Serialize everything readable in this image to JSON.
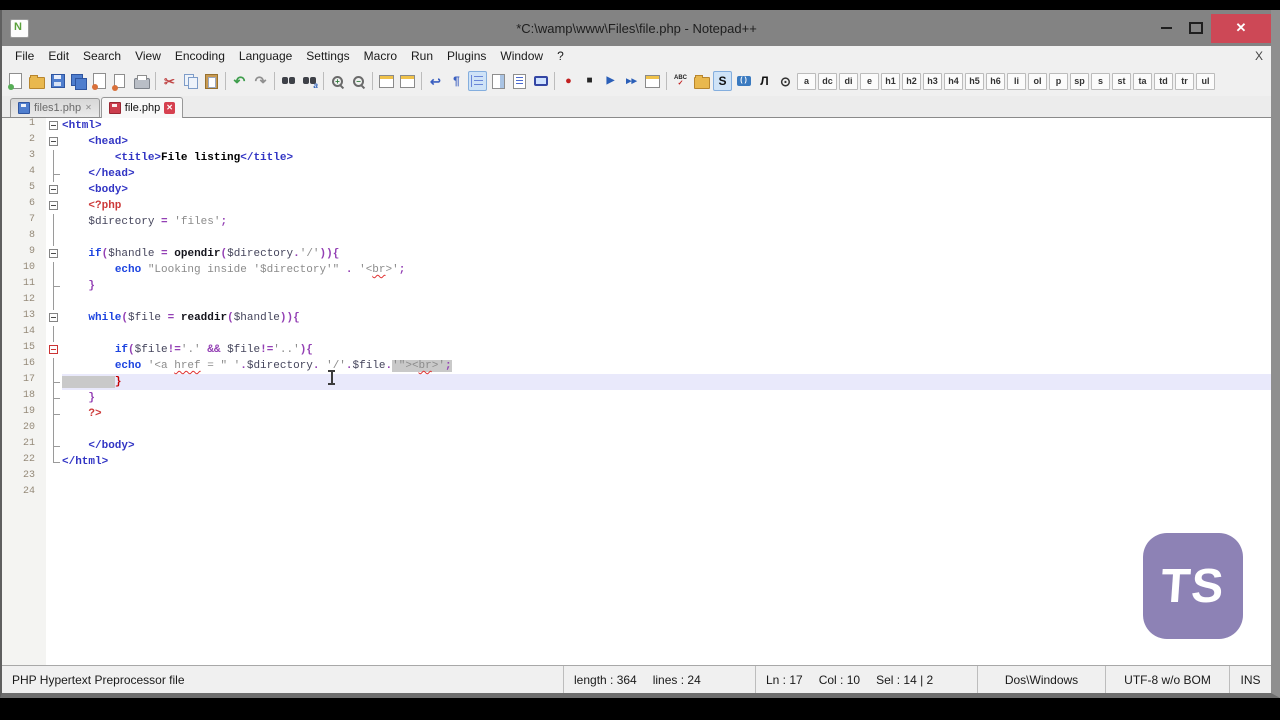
{
  "window": {
    "title": "*C:\\wamp\\www\\Files\\file.php - Notepad++"
  },
  "menu": {
    "items": [
      "File",
      "Edit",
      "Search",
      "View",
      "Encoding",
      "Language",
      "Settings",
      "Macro",
      "Run",
      "Plugins",
      "Window",
      "?"
    ],
    "close_label": "X"
  },
  "toolbar": {
    "items": [
      {
        "n": "new-file-icon",
        "k": "page",
        "c": "#57ae57"
      },
      {
        "n": "open-file-icon",
        "k": "folder"
      },
      {
        "n": "save-icon",
        "k": "floppy"
      },
      {
        "n": "save-all-icon",
        "k": "floppy2"
      },
      {
        "n": "close-file-icon",
        "k": "page",
        "c": "#d9703a"
      },
      {
        "n": "close-all-icon",
        "k": "page2"
      },
      {
        "n": "print-icon",
        "k": "printer"
      },
      {
        "k": "sep"
      },
      {
        "n": "cut-icon",
        "k": "g",
        "g": "✂",
        "c": "#c04545",
        "fs": 13
      },
      {
        "n": "copy-icon",
        "k": "copy"
      },
      {
        "n": "paste-icon",
        "k": "paste"
      },
      {
        "k": "sep"
      },
      {
        "n": "undo-icon",
        "k": "g",
        "g": "↶",
        "c": "#3f9e4d",
        "fs": 14
      },
      {
        "n": "redo-icon",
        "k": "g",
        "g": "↷",
        "c": "#909090",
        "fs": 14
      },
      {
        "k": "sep"
      },
      {
        "n": "find-icon",
        "k": "binoc"
      },
      {
        "n": "replace-icon",
        "k": "binoc2"
      },
      {
        "k": "sep"
      },
      {
        "n": "zoom-in-icon",
        "k": "zoom",
        "g": "+"
      },
      {
        "n": "zoom-out-icon",
        "k": "zoom",
        "g": "−"
      },
      {
        "k": "sep"
      },
      {
        "n": "sync-vertical-icon",
        "k": "docwin"
      },
      {
        "n": "sync-horizontal-icon",
        "k": "docwin"
      },
      {
        "k": "sep"
      },
      {
        "n": "word-wrap-icon",
        "k": "g",
        "g": "↩",
        "c": "#3a5fc0",
        "fs": 13
      },
      {
        "n": "show-all-chars-icon",
        "k": "g",
        "g": "¶",
        "c": "#3a5fc0",
        "fs": 12
      },
      {
        "n": "indent-guide-icon",
        "k": "guide",
        "act": true
      },
      {
        "n": "doc-map-icon",
        "k": "docmap"
      },
      {
        "n": "function-list-icon",
        "k": "flist"
      },
      {
        "n": "monitoring-icon",
        "k": "monitor"
      },
      {
        "k": "sep"
      },
      {
        "n": "macro-record-icon",
        "k": "g",
        "g": "●",
        "c": "#c22020",
        "fs": 11
      },
      {
        "n": "macro-stop-icon",
        "k": "g",
        "g": "■",
        "c": "#262626",
        "fs": 10
      },
      {
        "n": "macro-play-icon",
        "k": "g",
        "g": "▶",
        "c": "#2b5fb8",
        "fs": 10
      },
      {
        "n": "macro-run-multi-icon",
        "k": "g",
        "g": "▶▶",
        "c": "#2b5fb8",
        "fs": 7
      },
      {
        "n": "macro-save-icon",
        "k": "docwin"
      },
      {
        "k": "sep"
      },
      {
        "n": "spell-check-icon",
        "k": "abc"
      },
      {
        "n": "plugin-folder-icon",
        "k": "folder"
      },
      {
        "n": "style-token-icon",
        "k": "g",
        "g": "S",
        "c": "#111111",
        "fs": 12,
        "act": true
      },
      {
        "n": "preview-monitor-icon",
        "k": "mon2"
      },
      {
        "n": "textfx-icon",
        "k": "g",
        "g": "Л",
        "c": "#111111",
        "fs": 12
      },
      {
        "n": "clock-icon",
        "k": "g",
        "g": "⊙",
        "c": "#333333",
        "fs": 13
      }
    ],
    "tag_buttons": [
      "a",
      "dc",
      "di",
      "e",
      "h1",
      "h2",
      "h3",
      "h4",
      "h5",
      "h6",
      "li",
      "ol",
      "p",
      "sp",
      "s",
      "st",
      "ta",
      "td",
      "tr",
      "ul"
    ]
  },
  "tabs": [
    {
      "label": "files1.php",
      "modified": false,
      "active": false,
      "close_glyph": "✕"
    },
    {
      "label": "file.php",
      "modified": true,
      "active": true,
      "close_glyph": "✕"
    }
  ],
  "editor": {
    "current_line": 17,
    "lines": [
      {
        "n": 1,
        "f": "minus",
        "s": [
          [
            "tag",
            "<html>"
          ]
        ]
      },
      {
        "n": 2,
        "f": "minus",
        "s": [
          [
            "pl",
            "    "
          ],
          [
            "tag",
            "<head>"
          ]
        ]
      },
      {
        "n": 3,
        "f": "line",
        "s": [
          [
            "pl",
            "        "
          ],
          [
            "tag",
            "<title>"
          ],
          [
            "txt",
            "File listing"
          ],
          [
            "tag",
            "</title>"
          ]
        ]
      },
      {
        "n": 4,
        "f": "tick",
        "s": [
          [
            "pl",
            "    "
          ],
          [
            "tag",
            "</head>"
          ]
        ]
      },
      {
        "n": 5,
        "f": "minus",
        "s": [
          [
            "pl",
            "    "
          ],
          [
            "tag",
            "<body>"
          ]
        ]
      },
      {
        "n": 6,
        "f": "minus",
        "s": [
          [
            "pl",
            "    "
          ],
          [
            "php",
            "<?php"
          ]
        ]
      },
      {
        "n": 7,
        "f": "line",
        "s": [
          [
            "pl",
            "    "
          ],
          [
            "var",
            "$directory"
          ],
          [
            "pl",
            " "
          ],
          [
            "op",
            "="
          ],
          [
            "pl",
            " "
          ],
          [
            "str",
            "'files'"
          ],
          [
            "op",
            ";"
          ]
        ]
      },
      {
        "n": 8,
        "f": "line",
        "s": []
      },
      {
        "n": 9,
        "f": "minus",
        "s": [
          [
            "pl",
            "    "
          ],
          [
            "kw",
            "if"
          ],
          [
            "op",
            "("
          ],
          [
            "var",
            "$handle"
          ],
          [
            "pl",
            " "
          ],
          [
            "op",
            "="
          ],
          [
            "pl",
            " "
          ],
          [
            "fn",
            "opendir"
          ],
          [
            "op",
            "("
          ],
          [
            "var",
            "$directory"
          ],
          [
            "op",
            "."
          ],
          [
            "str",
            "'/'"
          ],
          [
            "op",
            ")){"
          ]
        ]
      },
      {
        "n": 10,
        "f": "line",
        "s": [
          [
            "pl",
            "        "
          ],
          [
            "kw",
            "echo"
          ],
          [
            "pl",
            " "
          ],
          [
            "str",
            "\"Looking inside '$directory'\""
          ],
          [
            "pl",
            " "
          ],
          [
            "op",
            "."
          ],
          [
            "pl",
            " "
          ],
          [
            "str",
            "'<"
          ],
          [
            "strq",
            "br"
          ],
          [
            "str",
            ">'"
          ],
          [
            "op",
            ";"
          ]
        ]
      },
      {
        "n": 11,
        "f": "tick",
        "s": [
          [
            "pl",
            "    "
          ],
          [
            "op",
            "}"
          ]
        ]
      },
      {
        "n": 12,
        "f": "line",
        "s": []
      },
      {
        "n": 13,
        "f": "minus",
        "s": [
          [
            "pl",
            "    "
          ],
          [
            "kw",
            "while"
          ],
          [
            "op",
            "("
          ],
          [
            "var",
            "$file"
          ],
          [
            "pl",
            " "
          ],
          [
            "op",
            "="
          ],
          [
            "pl",
            " "
          ],
          [
            "fn",
            "readdir"
          ],
          [
            "op",
            "("
          ],
          [
            "var",
            "$handle"
          ],
          [
            "op",
            ")){"
          ]
        ]
      },
      {
        "n": 14,
        "f": "line",
        "s": []
      },
      {
        "n": 15,
        "f": "minusred",
        "s": [
          [
            "pl",
            "        "
          ],
          [
            "kw",
            "if"
          ],
          [
            "op",
            "("
          ],
          [
            "var",
            "$file"
          ],
          [
            "op",
            "!="
          ],
          [
            "str",
            "'.'"
          ],
          [
            "pl",
            " "
          ],
          [
            "op",
            "&&"
          ],
          [
            "pl",
            " "
          ],
          [
            "var",
            "$file"
          ],
          [
            "op",
            "!="
          ],
          [
            "str",
            "'..'"
          ],
          [
            "op",
            "){"
          ]
        ]
      },
      {
        "n": 16,
        "f": "line",
        "s": [
          [
            "pl",
            "        "
          ],
          [
            "kw",
            "echo"
          ],
          [
            "pl",
            " "
          ],
          [
            "str",
            "'<a "
          ],
          [
            "strq",
            "href"
          ],
          [
            "str",
            " = \" '"
          ],
          [
            "op",
            "."
          ],
          [
            "var",
            "$directory"
          ],
          [
            "op",
            "."
          ],
          [
            "pl",
            " "
          ],
          [
            "str",
            "'/'"
          ],
          [
            "op",
            "."
          ],
          [
            "var",
            "$file"
          ],
          [
            "op",
            "."
          ],
          [
            "str sel",
            "'\"><"
          ],
          [
            "strq sel",
            "br"
          ],
          [
            "str sel",
            ">'"
          ],
          [
            "op sel",
            ";"
          ]
        ]
      },
      {
        "n": 17,
        "f": "tick",
        "s": [
          [
            "pl sel",
            "        "
          ],
          [
            "brace",
            "}"
          ]
        ]
      },
      {
        "n": 18,
        "f": "tick",
        "s": [
          [
            "pl",
            "    "
          ],
          [
            "op",
            "}"
          ]
        ]
      },
      {
        "n": 19,
        "f": "tick",
        "s": [
          [
            "pl",
            "    "
          ],
          [
            "php",
            "?>"
          ]
        ]
      },
      {
        "n": 20,
        "f": "line",
        "s": []
      },
      {
        "n": 21,
        "f": "tick",
        "s": [
          [
            "pl",
            "    "
          ],
          [
            "tag",
            "</body>"
          ]
        ]
      },
      {
        "n": 22,
        "f": "end",
        "s": [
          [
            "tag",
            "</html>"
          ]
        ]
      },
      {
        "n": 23,
        "f": "none",
        "s": []
      },
      {
        "n": 24,
        "f": "none",
        "s": []
      }
    ]
  },
  "status": {
    "doc_type": "PHP Hypertext Preprocessor file",
    "length_label": "length : 364",
    "lines_label": "lines : 24",
    "ln": "Ln : 17",
    "col": "Col : 10",
    "sel": "Sel : 14 | 2",
    "eol": "Dos\\Windows",
    "encoding": "UTF-8 w/o BOM",
    "mode": "INS"
  },
  "watermark": {
    "text": "TS"
  }
}
